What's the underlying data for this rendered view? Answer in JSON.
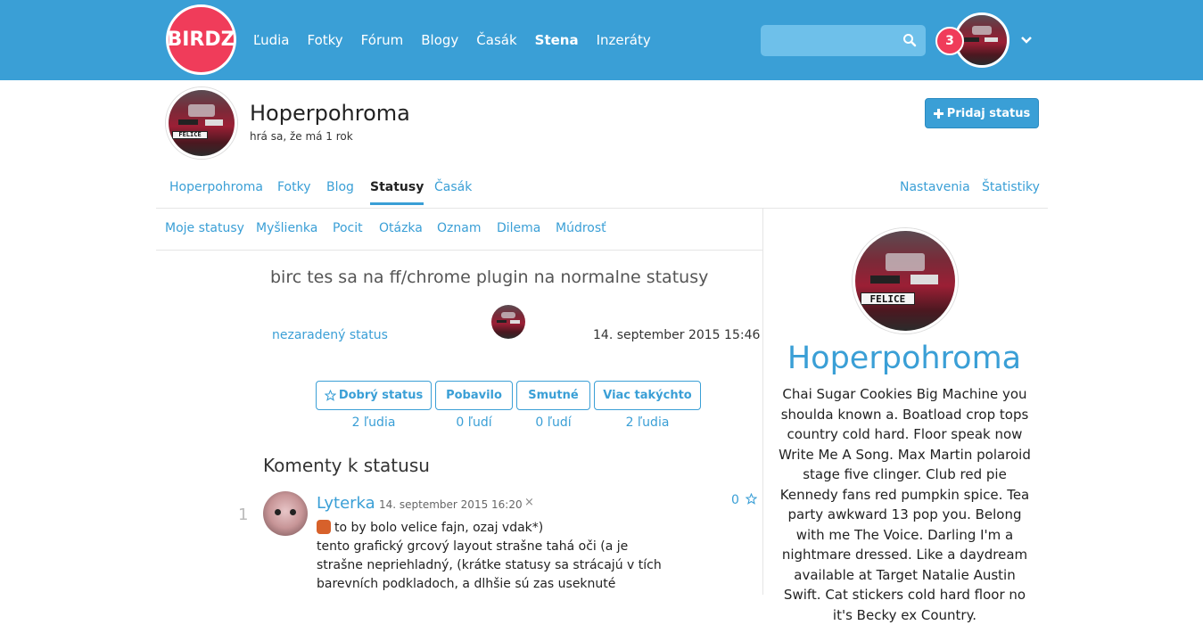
{
  "brand": {
    "logo": "BIRDZ",
    "accent": "#3a9fd6",
    "logo_color": "#f03c5a"
  },
  "mainnav": {
    "items": [
      "Ľudia",
      "Fotky",
      "Fórum",
      "Blogy",
      "Časák",
      "Stena",
      "Inzeráty"
    ],
    "active": "Stena"
  },
  "search": {
    "placeholder": "",
    "icon": "search-icon"
  },
  "notifications": {
    "count": "3"
  },
  "profile": {
    "name": "Hoperpohroma",
    "subtitle": "hrá sa, že má 1 rok",
    "add_status": "Pridaj status"
  },
  "profnav": {
    "tabs": [
      "Hoperpohroma",
      "Fotky",
      "Blog",
      "Statusy",
      "Časák"
    ],
    "active": "Statusy",
    "right": [
      "Nastavenia",
      "Štatistiky"
    ]
  },
  "subnav": [
    "Moje statusy",
    "Myšlienka",
    "Pocit",
    "Otázka",
    "Oznam",
    "Dilema",
    "Múdrosť"
  ],
  "status": {
    "text": "birc tes sa na ff/chrome plugin na normalne statusy",
    "category": "nezaradený status",
    "date": "14. september 2015 15:46",
    "reactions": [
      {
        "label": "Dobrý status",
        "count": "2 ľudia"
      },
      {
        "label": "Pobavilo",
        "count": "0 ľudí"
      },
      {
        "label": "Smutné",
        "count": "0 ľudí"
      },
      {
        "label": "Viac takýchto",
        "count": "2 ľudia"
      }
    ]
  },
  "comments": {
    "title": "Komenty k statusu",
    "items": [
      {
        "number": "1",
        "author": "Lyterka",
        "date": "14. september 2015 16:20",
        "close": "×",
        "stars": "0",
        "line1": "to by bolo velice fajn, ozaj vdak*)",
        "line2": "tento grafický grcový layout strašne tahá oči (a je",
        "line3": "strašne nepriehladný, (krátke statusy sa strácajú v tích",
        "line4": "barevních podkladoch, a dlhšie sú zas useknuté"
      }
    ]
  },
  "sidebar": {
    "name": "Hoperpohroma",
    "bio": "Chai Sugar Cookies Big Machine you shoulda known a. Boatload crop tops country cold hard. Floor speak now Write Me A Song. Max Martin polaroid stage five clinger. Club red pie Kennedy fans red pumpkin spice. Tea party awkward 13 pop you. Belong with me The Voice. Darling I'm a nightmare dressed. Like a daydream available at Target Natalie Austin Swift. Cat stickers cold hard floor no it's Becky ex Country."
  },
  "plate_text": "FELICE"
}
